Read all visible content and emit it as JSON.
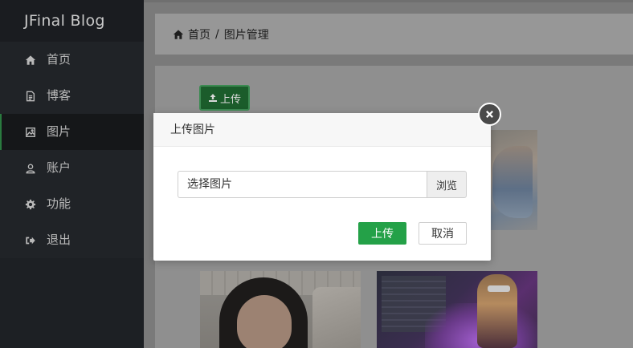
{
  "sidebar": {
    "brand": "JFinal Blog",
    "items": [
      {
        "label": "首页",
        "icon": "home-icon"
      },
      {
        "label": "博客",
        "icon": "document-icon"
      },
      {
        "label": "图片",
        "icon": "image-icon",
        "active": true
      },
      {
        "label": "账户",
        "icon": "user-icon"
      },
      {
        "label": "功能",
        "icon": "gear-icon"
      },
      {
        "label": "退出",
        "icon": "sign-out-icon"
      }
    ]
  },
  "breadcrumb": {
    "home": "首页",
    "separator": "/",
    "current": "图片管理"
  },
  "toolbar": {
    "upload_label": "上传"
  },
  "modal": {
    "title": "上传图片",
    "file_placeholder": "选择图片",
    "browse_label": "浏览",
    "upload_label": "上传",
    "cancel_label": "取消"
  },
  "colors": {
    "primary_green": "#24a148",
    "sidebar_bg": "#1d2024"
  }
}
